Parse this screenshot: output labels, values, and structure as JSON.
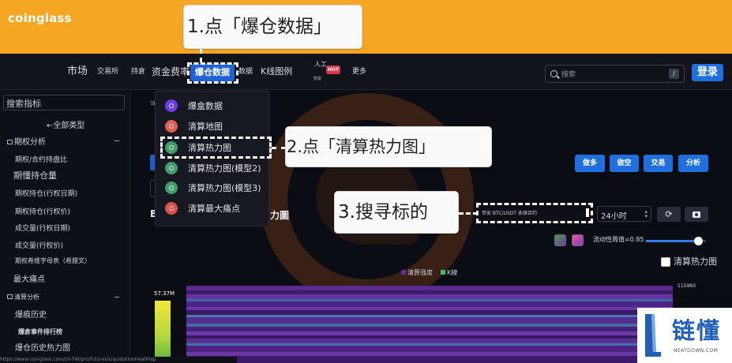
{
  "app": {
    "logo": "coinglass"
  },
  "nav": {
    "market": "市场",
    "exchanges": "交易所",
    "holdings": "持倉",
    "funding": "资金费率",
    "liquidation": "爆仓数据",
    "data": "数据",
    "kline": "K线图例",
    "ai": "人工",
    "ai_sub": "智能",
    "hot": "HOT",
    "more": "更多"
  },
  "search": {
    "placeholder": "搜索",
    "shortcut": "/"
  },
  "login_label": "登录",
  "sidebar": {
    "search_label": "搜索指标",
    "all_types": "←全部类型",
    "section_options": "期权分析",
    "options_items": [
      "期权/合约持盘比",
      "期懂持仓量",
      "期权持仓(行权日期)",
      "期权持仓(行权价)",
      "成交量(行权日期)",
      "成交量(行权价)",
      "期权希维字母表（希腊文）",
      "最大痛点"
    ],
    "section_liq": "清算分析",
    "liq_items": [
      "爆痕历史",
      "爆倉事件排行榜",
      "爆仓历史热力图"
    ]
  },
  "dropdown": {
    "items": [
      {
        "label": "爆盒数据",
        "color": "#6b3de8"
      },
      {
        "label": "清算地图",
        "color": "#e0604f"
      },
      {
        "label": "清算热力图",
        "color": "#3f9e6a"
      },
      {
        "label": "清算热力图(模型2)",
        "color": "#3f9e6a"
      },
      {
        "label": "清算热力图(模型3)",
        "color": "#3f9e6a"
      },
      {
        "label": "清算最大痛点",
        "color": "#e0504a"
      }
    ]
  },
  "callouts": {
    "step1": "1.点「爆仓数据」",
    "step2": "2.点「清算热力图」",
    "step3": "3.搜寻标的"
  },
  "main": {
    "stub": "ञ",
    "title_left": "B",
    "title_right": "力圖",
    "buttons": [
      "做多",
      "做空",
      "交易",
      "分析"
    ],
    "symbol_value": "币安 BTC/USDT 永续合约",
    "period_value": "24小时",
    "threshold_label": "流动性周值=0.85",
    "checkbox_label": "清算热力图",
    "legend_intensity": "清算强度",
    "legend_kline": "K線",
    "bar_value": "57.37M",
    "y_tick": "115960",
    "url": "https://www.coinglass.com/zh-TW/pro/futures/LiquidationHeatMap"
  },
  "colors": {
    "accent": "#1f6fe0",
    "banner": "#f5a623",
    "heat_purple": "#4a1a7a",
    "heat_blue": "#3a6a9e"
  },
  "brand": {
    "name": "链懂",
    "url": "NEATDOWN.COM"
  },
  "chart_data": {
    "type": "heatmap",
    "legend": [
      "清算强度",
      "K線"
    ],
    "bar_value": "57.37M",
    "y_ticks": [
      115960
    ]
  }
}
